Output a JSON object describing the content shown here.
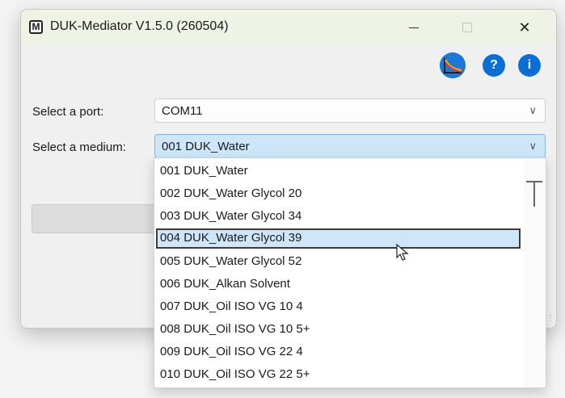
{
  "window": {
    "title": "DUK-Mediator V1.5.0 (260504)",
    "app_icon_letter": "M",
    "close_glyph": "✕"
  },
  "toolbar": {
    "help_glyph": "?",
    "info_glyph": "i",
    "chart_icon": "viscosity-chart-icon",
    "accent_color": "#0a6fd3"
  },
  "form": {
    "port_label": "Select a port:",
    "port_value": "COM11",
    "medium_label": "Select a medium:",
    "medium_value": "001 DUK_Water"
  },
  "dropdown": {
    "items": [
      "001 DUK_Water",
      "002 DUK_Water Glycol 20",
      "003 DUK_Water Glycol 34",
      "004 DUK_Water Glycol 39",
      "005 DUK_Water Glycol 52",
      "006 DUK_Alkan Solvent",
      "007 DUK_Oil ISO VG 10 4",
      "008 DUK_Oil ISO VG 10 5+",
      "009 DUK_Oil ISO VG 22 4",
      "010 DUK_Oil ISO VG 22 5+"
    ],
    "hovered_index": 3
  }
}
